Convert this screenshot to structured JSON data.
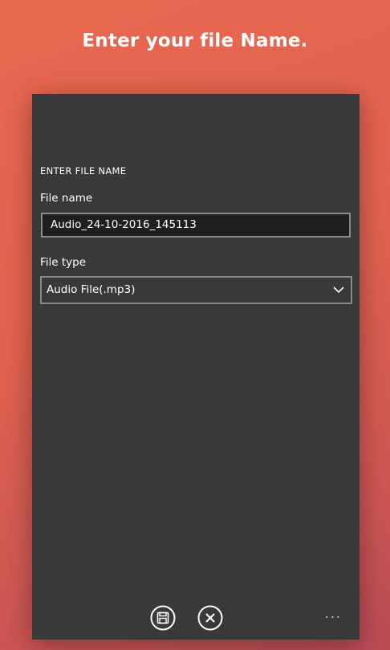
{
  "headline": "Enter your file Name.",
  "dialog": {
    "section_title": "ENTER FILE NAME",
    "file_name_label": "File name",
    "file_name_value": "Audio_24-10-2016_145113",
    "file_type_label": "File type",
    "file_type_selected": "Audio File(.mp3)"
  },
  "appbar": {
    "save_icon": "save-icon",
    "cancel_icon": "cancel-icon",
    "more_glyph": "..."
  },
  "colors": {
    "background_top": "#e8684f",
    "background_bottom": "#b94b55",
    "panel": "#393939",
    "textbox_bg": "#1f1f1f",
    "border": "#8a8a8a"
  }
}
